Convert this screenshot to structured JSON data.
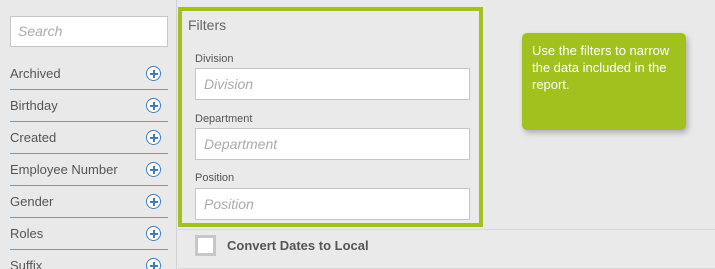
{
  "search": {
    "placeholder": "Search"
  },
  "fields": [
    {
      "label": "Archived"
    },
    {
      "label": "Birthday"
    },
    {
      "label": "Created"
    },
    {
      "label": "Employee Number"
    },
    {
      "label": "Gender"
    },
    {
      "label": "Roles"
    },
    {
      "label": "Suffix"
    }
  ],
  "filters": {
    "title": "Filters",
    "division": {
      "label": "Division",
      "placeholder": "Division"
    },
    "department": {
      "label": "Department",
      "placeholder": "Department"
    },
    "position": {
      "label": "Position",
      "placeholder": "Position"
    }
  },
  "convert": {
    "label": "Convert Dates to Local",
    "checked": false
  },
  "callout": {
    "text": "Use the filters to narrow the data included in the report."
  },
  "colors": {
    "accent_green": "#a1c11f",
    "link_blue": "#3a7ec4"
  },
  "icons": {
    "add": "plus-circle-icon"
  }
}
